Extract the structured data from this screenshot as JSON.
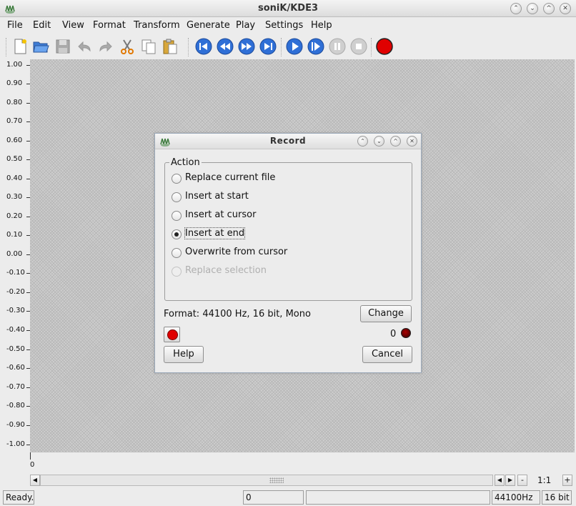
{
  "window": {
    "title": "soniK/KDE3"
  },
  "menu": [
    "File",
    "Edit",
    "View",
    "Format",
    "Transform",
    "Generate",
    "Play",
    "Settings",
    "Help"
  ],
  "toolbar": {
    "icons": [
      "new-file-icon",
      "open-folder-icon",
      "save-icon",
      "undo-icon",
      "redo-icon",
      "cut-icon",
      "copy-icon",
      "paste-icon",
      "skip-to-start-icon",
      "rewind-icon",
      "fast-forward-icon",
      "skip-to-end-icon",
      "play-icon",
      "play-from-cursor-icon",
      "pause-icon",
      "stop-icon",
      "record-icon"
    ]
  },
  "yaxis": {
    "ticks": [
      "1.00",
      "0.90",
      "0.80",
      "0.70",
      "0.60",
      "0.50",
      "0.40",
      "0.30",
      "0.20",
      "0.10",
      "0.00",
      "-0.10",
      "-0.20",
      "-0.30",
      "-0.40",
      "-0.50",
      "-0.60",
      "-0.70",
      "-0.80",
      "-0.90",
      "-1.00"
    ]
  },
  "xaxis": {
    "start_label": "0"
  },
  "zoom": {
    "ratio": "1:1",
    "minus": "-",
    "plus": "+"
  },
  "status": {
    "message": "Ready.",
    "position": "0",
    "extra": "",
    "sample_rate": "44100Hz",
    "bit_depth": "16 bit"
  },
  "dialog": {
    "title": "Record",
    "group_label": "Action",
    "options": [
      {
        "label": "Replace current file",
        "checked": false,
        "enabled": true
      },
      {
        "label": "Insert at start",
        "checked": false,
        "enabled": true
      },
      {
        "label": "Insert at cursor",
        "checked": false,
        "enabled": true
      },
      {
        "label": "Insert at end",
        "checked": true,
        "enabled": true
      },
      {
        "label": "Overwrite from cursor",
        "checked": false,
        "enabled": true
      },
      {
        "label": "Replace selection",
        "checked": false,
        "enabled": false
      }
    ],
    "format_text": "Format: 44100 Hz, 16 bit, Mono",
    "change_label": "Change",
    "record_count": "0",
    "help_label": "Help",
    "cancel_label": "Cancel"
  },
  "colors": {
    "record_red": "#e00000",
    "transport_blue": "#2f6fd6"
  }
}
